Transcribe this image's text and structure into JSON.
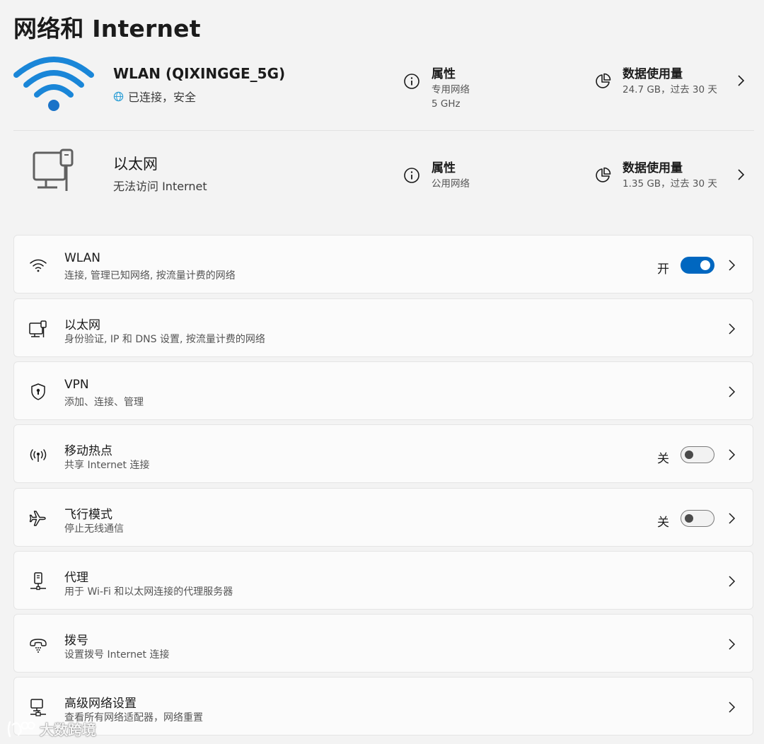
{
  "page": {
    "title": "网络和 Internet"
  },
  "wlan_hero": {
    "name": "WLAN (QIXINGGE_5G)",
    "status": "已连接，安全",
    "properties": {
      "title": "属性",
      "line1": "专用网络",
      "line2": "5 GHz"
    },
    "usage": {
      "title": "数据使用量",
      "value": "24.7 GB，过去 30 天"
    }
  },
  "ethernet_hero": {
    "name": "以太网",
    "status": "无法访问 Internet",
    "properties": {
      "title": "属性",
      "line1": "公用网络"
    },
    "usage": {
      "title": "数据使用量",
      "value": "1.35 GB，过去 30 天"
    }
  },
  "settings": [
    {
      "title": "WLAN",
      "subtitle": "连接, 管理已知网络, 按流量计费的网络",
      "toggle_label": "开",
      "toggle_on": true,
      "icon": "wifi-icon"
    },
    {
      "title": "以太网",
      "subtitle": "身份验证, IP 和 DNS 设置, 按流量计费的网络",
      "icon": "ethernet-icon"
    },
    {
      "title": "VPN",
      "subtitle": "添加、连接、管理",
      "icon": "shield-icon"
    },
    {
      "title": "移动热点",
      "subtitle": "共享 Internet 连接",
      "toggle_label": "关",
      "toggle_on": false,
      "icon": "hotspot-icon"
    },
    {
      "title": "飞行模式",
      "subtitle": "停止无线通信",
      "toggle_label": "关",
      "toggle_on": false,
      "icon": "airplane-icon"
    },
    {
      "title": "代理",
      "subtitle": "用于 Wi-Fi 和以太网连接的代理服务器",
      "icon": "proxy-icon"
    },
    {
      "title": "拨号",
      "subtitle": "设置拨号 Internet 连接",
      "icon": "dialup-icon"
    },
    {
      "title": "高级网络设置",
      "subtitle": "查看所有网络适配器，网络重置",
      "icon": "advanced-network-icon"
    }
  ],
  "watermark": {
    "text": "大数跨境"
  },
  "colors": {
    "accent": "#0067c0",
    "background": "#f3f3f3",
    "card": "#fbfbfb"
  }
}
